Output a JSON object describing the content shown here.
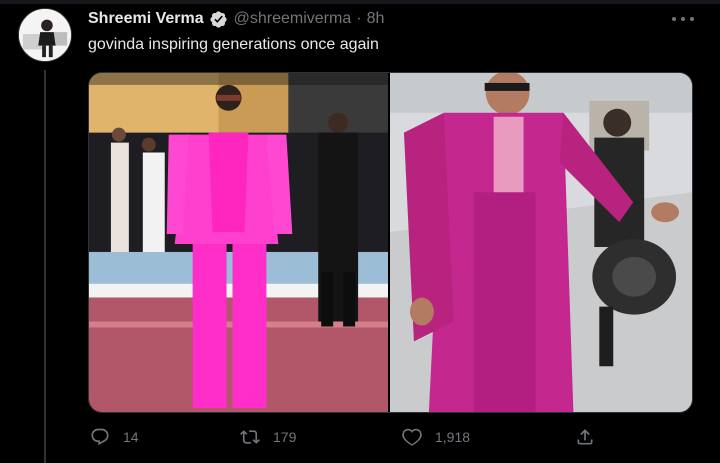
{
  "tweet": {
    "author_name": "Shreemi Verma",
    "handle": "@shreemiverma",
    "separator": "·",
    "time": "8h",
    "text": "govinda inspiring generations once again",
    "verified": true
  },
  "media": {
    "photos": [
      {
        "subject": "man in hot-pink suit on red carpet"
      },
      {
        "subject": "man in magenta suit outdoors"
      }
    ]
  },
  "actions": {
    "reply_count": "14",
    "retweet_count": "179",
    "like_count": "1,918"
  },
  "icons": {
    "reply": "reply-icon",
    "retweet": "retweet-icon",
    "like": "heart-icon",
    "share": "share-icon",
    "more": "more-icon",
    "verified": "verified-badge-icon"
  },
  "colors": {
    "background": "#000000",
    "text_primary": "#e7e9ea",
    "text_secondary": "#71767b",
    "verified_badge": "#d9d9d9",
    "hot_pink": "#ff2ec8",
    "magenta": "#c4288f"
  }
}
